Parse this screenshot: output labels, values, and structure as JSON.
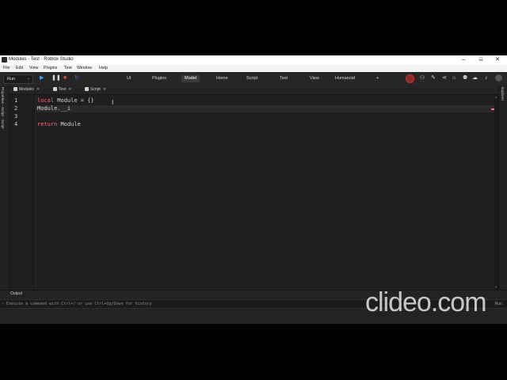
{
  "window": {
    "title": "Modules - Test - Roblox Studio",
    "minimize": "–",
    "maximize": "□",
    "close": "✕"
  },
  "menu": [
    "File",
    "Edit",
    "View",
    "Plugins",
    "Test",
    "Window",
    "Help"
  ],
  "toolbar": {
    "run_label": "Run",
    "run_chevron": "⌄",
    "tabs": [
      "UI",
      "Plugins",
      "Model",
      "Home",
      "Script",
      "Test",
      "View",
      "Humanoid",
      "+"
    ],
    "active_tab": "Model",
    "icons": {
      "play": "play-icon",
      "pause": "pause-icon",
      "stop": "stop-icon",
      "loop": "loop-icon"
    }
  },
  "sidebars": {
    "left_label": "Properties · Script · Script",
    "right_label": "Explorer"
  },
  "doc_tabs": [
    {
      "label": "Modules",
      "close": "✕"
    },
    {
      "label": "Test",
      "close": "✕"
    },
    {
      "label": "Script",
      "close": "✕"
    }
  ],
  "editor": {
    "line_numbers": [
      "1",
      "2",
      "3",
      "4"
    ],
    "line1_kw": "local",
    "line1_rest": " Module = {}",
    "line2": "Module.__i",
    "line4_kw": "return",
    "line4_rest": " Module"
  },
  "output": {
    "label": "Output",
    "command_placeholder": "Execute a command with Ctrl+/ or use Ctrl+Up/Down for history",
    "prompt": "›",
    "run_label": "Run"
  },
  "watermark": "clideo.com",
  "colors": {
    "keyword": "#f86d7c",
    "active_tab_bg": "#3a3a3a",
    "editor_bg": "#1e1e1e"
  }
}
